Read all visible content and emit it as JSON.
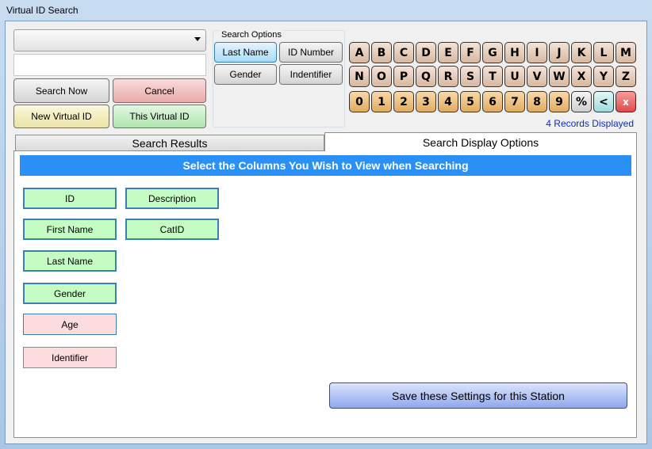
{
  "window": {
    "title": "Virtual ID Search"
  },
  "search": {
    "input_value": ""
  },
  "actions": {
    "search_now": "Search Now",
    "cancel": "Cancel",
    "new_virtual_id": "New Virtual ID",
    "this_virtual_id": "This Virtual ID"
  },
  "search_options": {
    "title": "Search Options",
    "options": [
      "Last Name",
      "ID Number",
      "Gender",
      "Indentifier"
    ],
    "selected": "Last Name"
  },
  "keyboard": {
    "row1": [
      "A",
      "B",
      "C",
      "D",
      "E",
      "F",
      "G",
      "H",
      "I",
      "J",
      "K",
      "L",
      "M"
    ],
    "row2": [
      "N",
      "O",
      "P",
      "Q",
      "R",
      "S",
      "T",
      "U",
      "V",
      "W",
      "X",
      "Y",
      "Z"
    ],
    "row3": [
      "0",
      "1",
      "2",
      "3",
      "4",
      "5",
      "6",
      "7",
      "8",
      "9",
      "%",
      "<",
      "x"
    ]
  },
  "status": {
    "records": "4 Records Displayed"
  },
  "tabs": {
    "search_results": "Search Results",
    "display_options": "Search Display Options",
    "active": "display_options"
  },
  "display_options": {
    "banner": "Select the Columns You Wish to View when Searching",
    "columns": [
      {
        "label": "ID",
        "enabled": true
      },
      {
        "label": "First Name",
        "enabled": true
      },
      {
        "label": "Last Name",
        "enabled": true
      },
      {
        "label": "Gender",
        "enabled": true
      },
      {
        "label": "Age",
        "enabled": false
      },
      {
        "label": "Identifier",
        "enabled": false
      },
      {
        "label": "Description",
        "enabled": true
      },
      {
        "label": "CatID",
        "enabled": true
      }
    ],
    "save": "Save these Settings for this Station"
  },
  "colors": {
    "banner": "#2b90f5",
    "enabled": "#c4fcc4",
    "disabled": "#fcdcdc",
    "records_text": "#0d2fb5"
  }
}
